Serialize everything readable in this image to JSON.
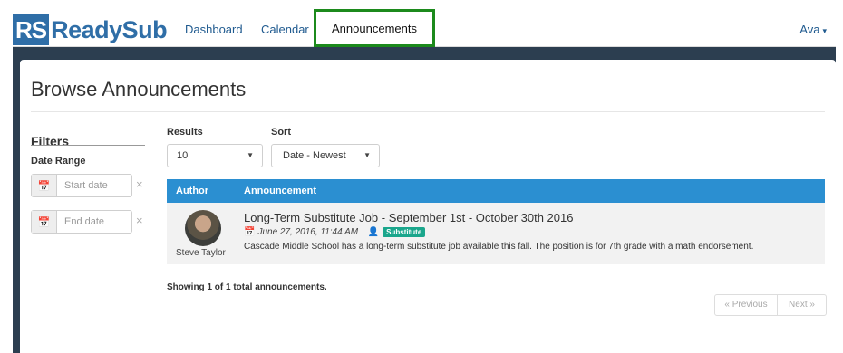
{
  "navbar": {
    "brand_initials": "RS",
    "brand_name": "ReadySub",
    "links": [
      {
        "label": "Dashboard"
      },
      {
        "label": "Calendar"
      },
      {
        "label": "Announcements",
        "active": true
      }
    ],
    "user": "Ava",
    "user_caret": "▾"
  },
  "page": {
    "title": "Browse Announcements"
  },
  "filters": {
    "title": "Filters",
    "date_range_label": "Date Range",
    "start_placeholder": "Start date",
    "end_placeholder": "End date",
    "calendar_icon": "calendar-icon",
    "clear_symbol": "×"
  },
  "controls": {
    "results_label": "Results",
    "results_value": "10",
    "sort_label": "Sort",
    "sort_value": "Date - Newest",
    "caret": "▼"
  },
  "table": {
    "headers": {
      "author": "Author",
      "announcement": "Announcement"
    },
    "rows": [
      {
        "author": "Steve Taylor",
        "title": "Long-Term Substitute Job - September 1st - October 30th 2016",
        "date": "June 27, 2016, 11:44 AM",
        "separator": "|",
        "badge": "Substitute",
        "body": "Cascade Middle School has a long-term substitute job available this fall. The position is for 7th grade with a math endorsement."
      }
    ]
  },
  "footer": {
    "showing": "Showing 1 of 1 total announcements.",
    "prev": "« Previous",
    "next": "Next »"
  },
  "colors": {
    "brand": "#2f6ea7",
    "header_bar": "#2c3e50",
    "table_header": "#2b8fd1",
    "badge": "#1aa68c",
    "active_outline": "#1c8a1c"
  }
}
